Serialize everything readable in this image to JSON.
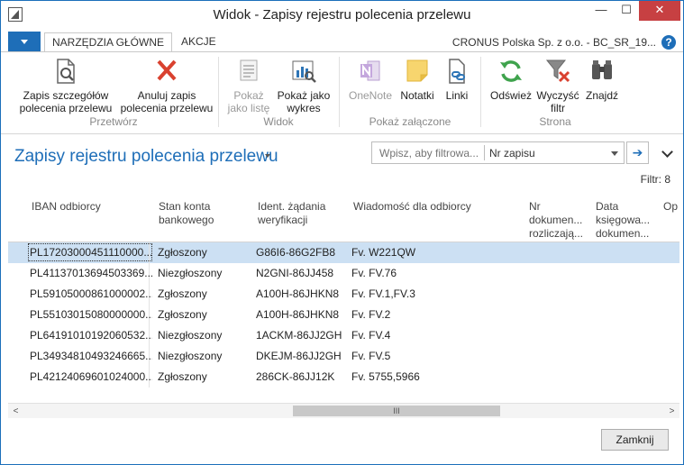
{
  "window": {
    "title": "Widok - Zapisy rejestru polecenia przelewu",
    "controls": {
      "minimize": "—",
      "maximize": "☐",
      "close": "✕"
    }
  },
  "tabs": [
    {
      "label": "NARZĘDZIA GŁÓWNE",
      "active": true
    },
    {
      "label": "AKCJE",
      "active": false
    }
  ],
  "company": "CRONUS Polska Sp. z o.o. - BC_SR_19...",
  "help_label": "?",
  "ribbon": {
    "buttons": {
      "zapis_szczegolow": {
        "line1": "Zapis szczegółów",
        "line2": "polecenia przelewu",
        "icon": "document-search-icon"
      },
      "anuluj_zapis": {
        "line1": "Anuluj zapis",
        "line2": "polecenia przelewu",
        "icon": "cancel-x-icon"
      },
      "pokaz_jako_liste": {
        "line1": "Pokaż",
        "line2": "jako listę",
        "icon": "list-view-icon",
        "disabled": true
      },
      "pokaz_jako_wykres": {
        "line1": "Pokaż jako",
        "line2": "wykres",
        "icon": "chart-view-icon"
      },
      "onenote": {
        "line1": "OneNote",
        "icon": "onenote-icon",
        "disabled": true
      },
      "notatki": {
        "line1": "Notatki",
        "icon": "notes-icon"
      },
      "linki": {
        "line1": "Linki",
        "icon": "links-icon"
      },
      "odswiez": {
        "line1": "Odśwież",
        "icon": "refresh-icon"
      },
      "wyczysc_filtr": {
        "line1": "Wyczyść",
        "line2": "filtr",
        "icon": "clear-filter-icon"
      },
      "znajdz": {
        "line1": "Znajdź",
        "icon": "binoculars-icon"
      }
    },
    "groups": {
      "przetworz": "Przetwórz",
      "widok": "Widok",
      "pokaz_zalaczone": "Pokaż załączone",
      "strona": "Strona"
    }
  },
  "page": {
    "title": "Zapisy rejestru polecenia przelewu",
    "search_placeholder": "Wpisz, aby filtrowa...",
    "search_field": "Nr zapisu",
    "filter_text": "Filtr: 8"
  },
  "columns": {
    "iban": "IBAN odbiorcy",
    "stan_1": "Stan konta",
    "stan_2": "bankowego",
    "ident_1": "Ident. żądania",
    "ident_2": "weryfikacji",
    "msg": "Wiadomość dla odbiorcy",
    "nr_dok_1": "Nr",
    "nr_dok_2": "dokumen...",
    "nr_dok_3": "rozliczają...",
    "data_1": "Data",
    "data_2": "księgowa...",
    "data_3": "dokumen...",
    "op": "Op"
  },
  "rows": [
    {
      "iban": "PL17203000451110000...",
      "stan": "Zgłoszony",
      "ident": "G86I6-86G2FB8",
      "msg": "Fv. W221QW",
      "selected": true
    },
    {
      "iban": "PL41137013694503369...",
      "stan": "Niezgłoszony",
      "ident": "N2GNI-86JJ458",
      "msg": "Fv. FV.76"
    },
    {
      "iban": "PL59105000861000002...",
      "stan": "Zgłoszony",
      "ident": "A100H-86JHKN8",
      "msg": "Fv. FV.1,FV.3"
    },
    {
      "iban": "PL55103015080000000...",
      "stan": "Zgłoszony",
      "ident": "A100H-86JHKN8",
      "msg": "Fv. FV.2"
    },
    {
      "iban": "PL64191010192060532...",
      "stan": "Niezgłoszony",
      "ident": "1ACKM-86JJ2GH",
      "msg": "Fv. FV.4"
    },
    {
      "iban": "PL34934810493246665...",
      "stan": "Niezgłoszony",
      "ident": "DKEJM-86JJ2GH",
      "msg": "Fv. FV.5"
    },
    {
      "iban": "PL42124069601024000...",
      "stan": "Zgłoszony",
      "ident": "286CK-86JJ12K",
      "msg": "Fv. 5755,5966"
    }
  ],
  "scrollbar": {
    "left": "<",
    "right": ">",
    "grip": "III"
  },
  "footer": {
    "close_label": "Zamknij"
  },
  "colors": {
    "accent": "#1e6eb8",
    "selected_row": "#cce0f3",
    "window_close": "#c74042"
  }
}
